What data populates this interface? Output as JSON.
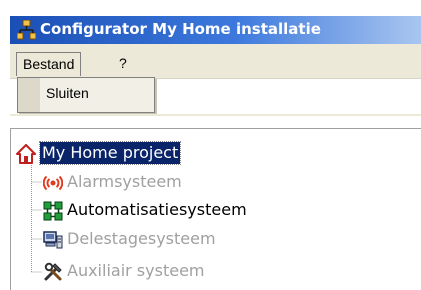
{
  "window": {
    "title": "Configurator My Home installatie"
  },
  "menubar": {
    "items": [
      {
        "label": "Bestand"
      },
      {
        "label": "?"
      }
    ]
  },
  "dropdown": {
    "items": [
      {
        "label": "Sluiten"
      }
    ]
  },
  "tree": {
    "root": {
      "label": "My Home project",
      "icon": "house-icon",
      "selected": true
    },
    "children": [
      {
        "label": "Alarmsysteem",
        "icon": "alarm-signal-icon",
        "enabled": false
      },
      {
        "label": "Automatisatiesysteem",
        "icon": "automation-grid-icon",
        "enabled": true
      },
      {
        "label": "Delestagesysteem",
        "icon": "load-shedding-icon",
        "enabled": false
      },
      {
        "label": "Auxiliair systeem",
        "icon": "tools-icon",
        "enabled": false
      }
    ]
  },
  "colors": {
    "titlebar_start": "#1a4fb6",
    "titlebar_end": "#a9c6f0",
    "selection": "#0a246a",
    "disabled_text": "#a0a0a0",
    "menu_bg": "#ece9d8"
  }
}
